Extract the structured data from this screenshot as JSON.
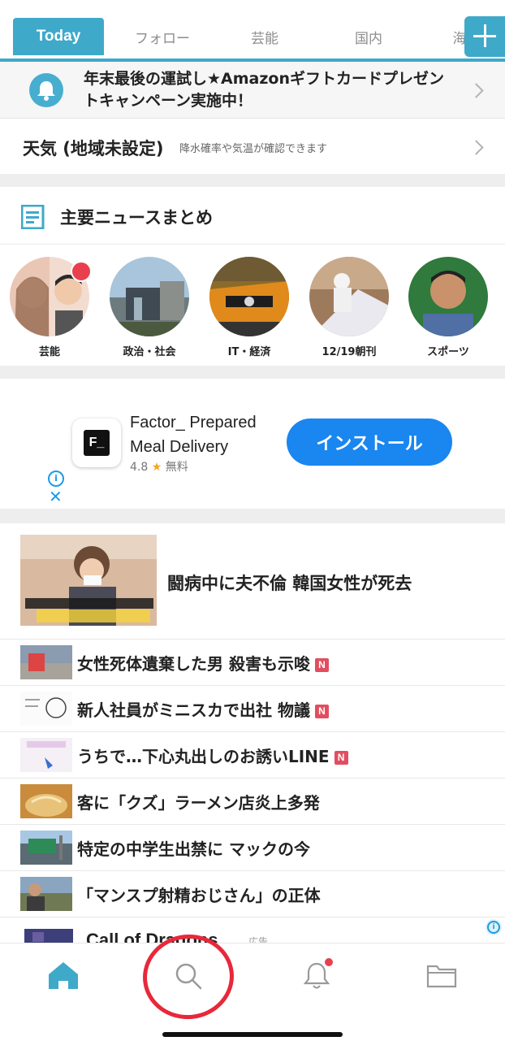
{
  "tabs": [
    {
      "label": "Today",
      "active": true
    },
    {
      "label": "フォロー"
    },
    {
      "label": "芸能"
    },
    {
      "label": "国内"
    },
    {
      "label": "海"
    }
  ],
  "notice": {
    "text": "年末最後の運試し★Amazonギフトカードプレゼントキャンペーン実施中！",
    "icon": "bell-icon"
  },
  "weather": {
    "title": "天気 (地域未設定)",
    "subtitle": "降水確率や気温が確認できます"
  },
  "summary": {
    "title": "主要ニュースまとめ",
    "categories": [
      {
        "label": "芸能",
        "unread": true
      },
      {
        "label": "政治・社会"
      },
      {
        "label": "IT・経済"
      },
      {
        "label": "12/19朝刊"
      },
      {
        "label": "スポーツ"
      }
    ]
  },
  "ad": {
    "app_name": "Factor_ Prepared Meal Delivery",
    "icon_text": "F_",
    "rating": "4.8",
    "star": "★",
    "price": "無料",
    "install_label": "インストール",
    "info_glyph": "i",
    "close_glyph": "✕"
  },
  "news": {
    "feature": {
      "title": "闘病中に夫不倫 韓国女性が死去"
    },
    "items": [
      {
        "title": "女性死体遺棄した男 殺害も示唆",
        "badge": "N"
      },
      {
        "title": "新人社員がミニスカで出社 物議",
        "badge": "N"
      },
      {
        "title": "うちで…下心丸出しのお誘いLINE",
        "badge": "N"
      },
      {
        "title": "客に「クズ」ラーメン店炎上多発"
      },
      {
        "title": "特定の中学生出禁に マックの今"
      },
      {
        "title": "「マンスプ射精おじさん」の正体"
      }
    ],
    "partial": {
      "title": "Call of Dragons",
      "ad_label": "広告"
    }
  },
  "colors": {
    "accent": "#3fa9c9",
    "install": "#1a86f0",
    "badge": "#e24e5f",
    "highlight": "#e8283a"
  },
  "bottom_nav": [
    {
      "name": "home",
      "icon": "home-icon",
      "active": true
    },
    {
      "name": "search",
      "icon": "search-icon"
    },
    {
      "name": "notifications",
      "icon": "bell-icon",
      "dot": true
    },
    {
      "name": "folder",
      "icon": "folder-icon"
    }
  ]
}
